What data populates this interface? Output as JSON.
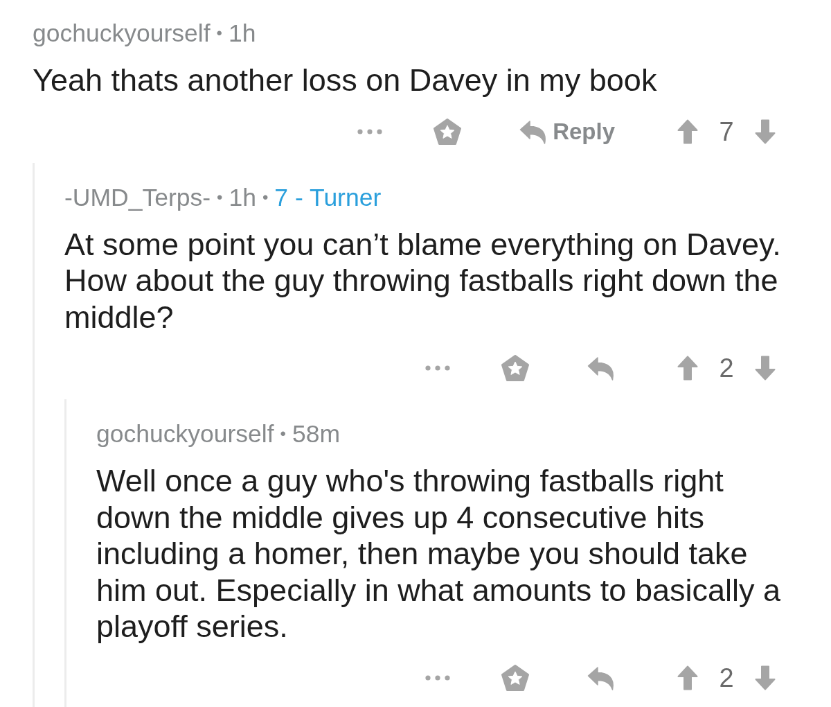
{
  "comments": [
    {
      "header": [
        {
          "kind": "author",
          "text": "gochuckyourself"
        },
        {
          "kind": "separator",
          "text": "•"
        },
        {
          "kind": "time",
          "text": "1h"
        }
      ],
      "body": "Yeah thats another loss on Davey in my book",
      "reply_label": "Reply",
      "score": "7",
      "children": [
        {
          "header": [
            {
              "kind": "author",
              "text": "-UMD_Terps-"
            },
            {
              "kind": "separator",
              "text": "•"
            },
            {
              "kind": "time",
              "text": "1h"
            },
            {
              "kind": "separator",
              "text": "•"
            },
            {
              "kind": "flair",
              "text": "7 - Turner"
            }
          ],
          "body": "At some point you can’t blame everything on Davey. How about the guy throwing fastballs right down the middle?",
          "score": "2",
          "children": [
            {
              "header": [
                {
                  "kind": "author",
                  "text": "gochuckyourself"
                },
                {
                  "kind": "separator",
                  "text": "•"
                },
                {
                  "kind": "time",
                  "text": "58m"
                }
              ],
              "body": "Well once a guy who's throwing fastballs right down the middle gives up 4 consecutive hits including a homer, then maybe you should take him out. Especially in what amounts to basically a playoff series.",
              "score": "2"
            }
          ]
        }
      ]
    }
  ]
}
